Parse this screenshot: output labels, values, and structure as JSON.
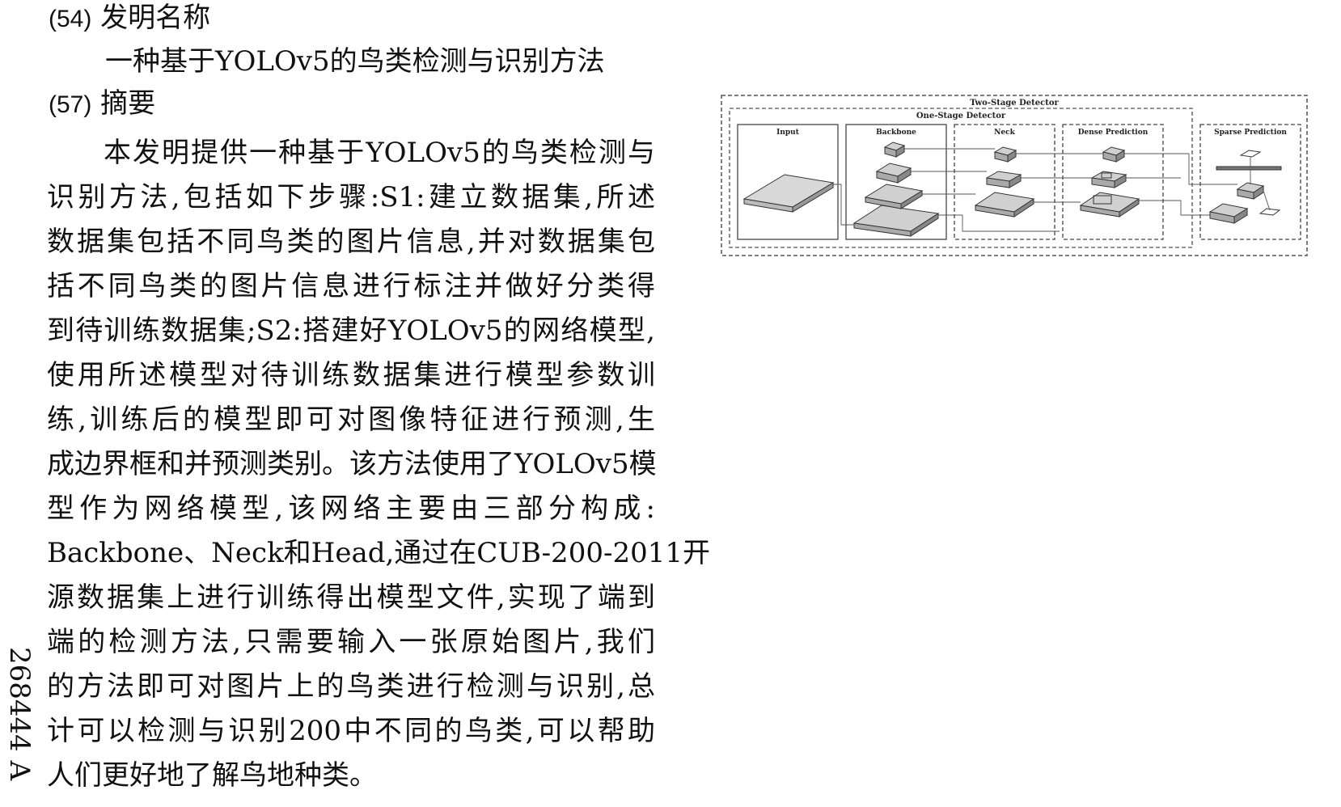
{
  "sections": {
    "title_heading": {
      "number": "(54)",
      "label": "发明名称"
    },
    "title_text": "一种基于YOLOv5的鸟类检测与识别方法",
    "abstract_heading": {
      "number": "(57)",
      "label": "摘要"
    },
    "abstract_lines": [
      "本发明提供一种基于YOLOv5的鸟类检测与",
      "识别方法,包括如下步骤:S1:建立数据集,所述",
      "数据集包括不同鸟类的图片信息,并对数据集包",
      "括不同鸟类的图片信息进行标注并做好分类得",
      "到待训练数据集;S2:搭建好YOLOv5的网络模型,",
      "使用所述模型对待训练数据集进行模型参数训",
      "练,训练后的模型即可对图像特征进行预测,生",
      "成边界框和并预测类别。该方法使用了YOLOv5模",
      "型作为网络模型,该网络主要由三部分构成:",
      "Backbone、Neck和Head,通过在CUB-200-2011开",
      "源数据集上进行训练得出模型文件,实现了端到",
      "端的检测方法,只需要输入一张原始图片,我们",
      "的方法即可对图片上的鸟类进行检测与识别,总",
      "计可以检测与识别200中不同的鸟类,可以帮助",
      "人们更好地了解鸟地种类。"
    ]
  },
  "side_code": "268444 A",
  "figure": {
    "outer_label": "Two-Stage Detector",
    "inner_label": "One-Stage Detector",
    "panels": [
      "Input",
      "Backbone",
      "Neck",
      "Dense Prediction",
      "Sparse Prediction"
    ]
  }
}
